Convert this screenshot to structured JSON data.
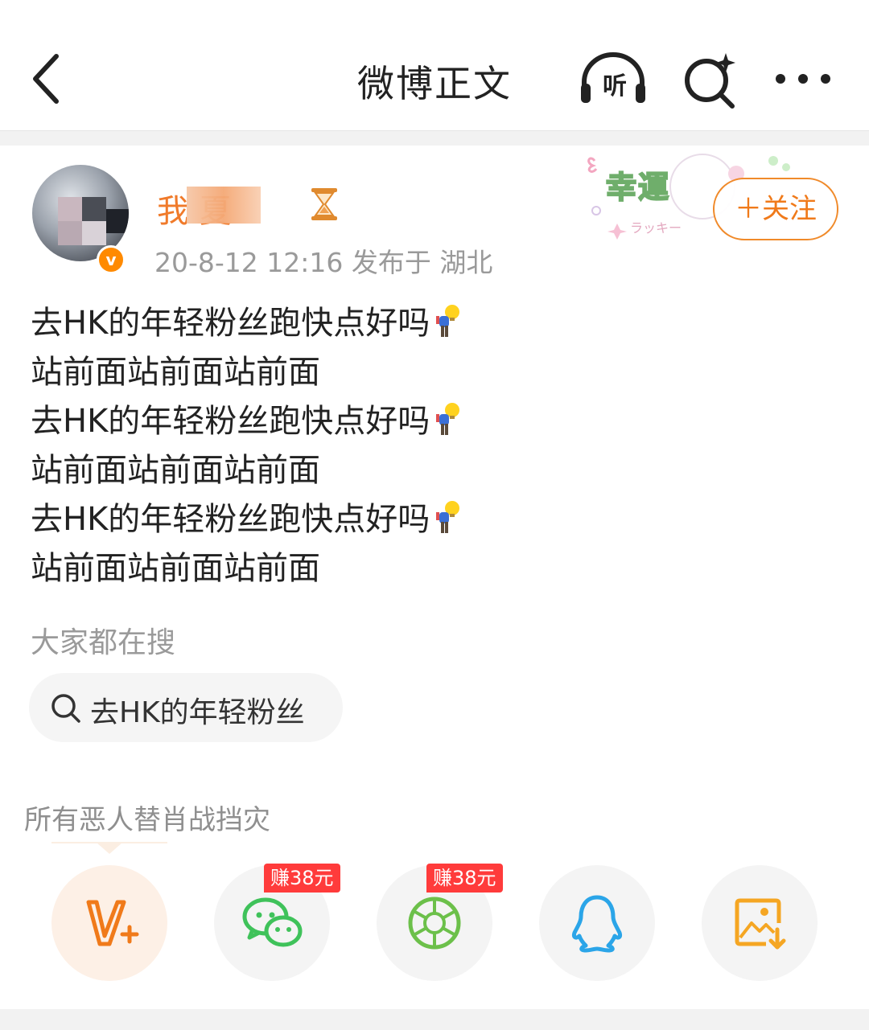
{
  "header": {
    "title": "微博正文",
    "listen_label": "听"
  },
  "post": {
    "username": "我 夏",
    "meta": "20-8-12 12:16  发布于 湖北",
    "follow_label": "＋关注",
    "verified_badge": "v",
    "sticker_text": "幸運",
    "sticker_subtext": "ラッキー",
    "lines": [
      "去HK的年轻粉丝跑快点好吗",
      "站前面站前面站前面",
      "去HK的年轻粉丝跑快点好吗",
      "站前面站前面站前面",
      "去HK的年轻粉丝跑快点好吗",
      "站前面站前面站前面"
    ]
  },
  "search_section": {
    "label": "大家都在搜",
    "chip": "去HK的年轻粉丝"
  },
  "footer": {
    "caption": "所有恶人替肖战挡灾"
  },
  "share": {
    "items": [
      {
        "icon": "vplus-icon"
      },
      {
        "icon": "wechat-icon",
        "badge": "赚38元"
      },
      {
        "icon": "moments-icon",
        "badge": "赚38元"
      },
      {
        "icon": "qq-icon"
      },
      {
        "icon": "save-image-icon"
      }
    ]
  },
  "colors": {
    "accent": "#f07a2a",
    "badge": "#ff3b3b",
    "wechat": "#3fc25a",
    "qq": "#2ba5e8",
    "save": "#f5a623"
  }
}
